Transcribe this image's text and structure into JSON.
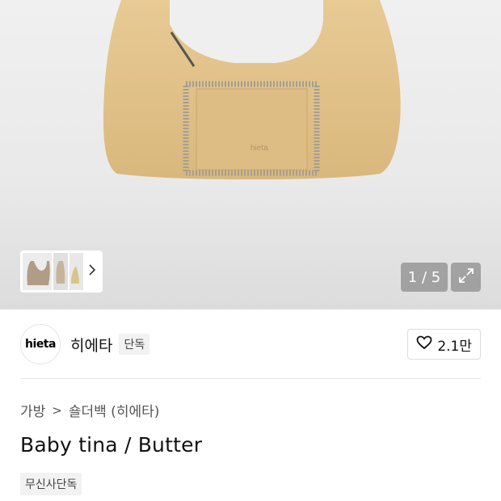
{
  "gallery": {
    "counter": "1 / 5",
    "expand_icon": "expand-icon",
    "thumb_next_icon": "chevron-right-icon"
  },
  "brand": {
    "logo_text": "hieta",
    "name": "히에타",
    "badge": "단독"
  },
  "like": {
    "icon": "heart-icon",
    "count": "2.1만"
  },
  "breadcrumb": {
    "category": "가방",
    "separator": ">",
    "subcategory": "숄더백 (히에타)"
  },
  "product": {
    "title": "Baby tina / Butter",
    "tag": "무신사단독"
  },
  "colors": {
    "bag": "#e3c48f",
    "fringe": "#9a9890",
    "overlay": "#969696"
  }
}
